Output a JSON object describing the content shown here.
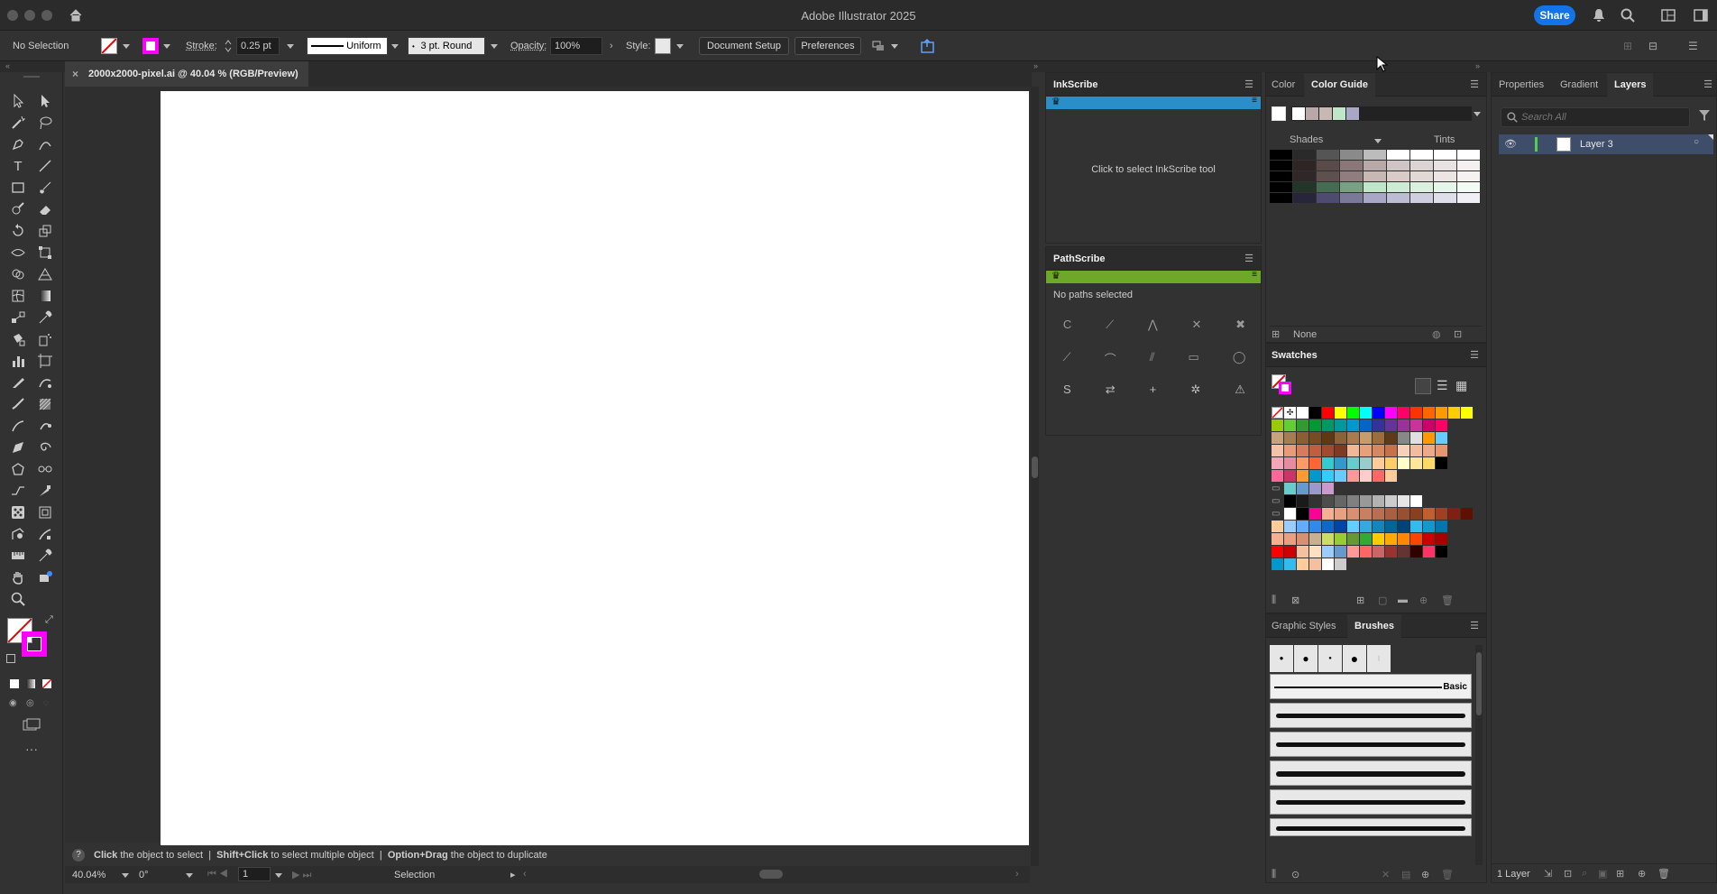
{
  "app": {
    "title": "Adobe Illustrator 2025",
    "share_label": "Share"
  },
  "control": {
    "selection": "No Selection",
    "stroke_label": "Stroke:",
    "stroke_value": "0.25 pt",
    "profile": "Uniform",
    "brush": "3 pt. Round",
    "opacity_label": "Opacity:",
    "opacity_value": "100%",
    "style_label": "Style:",
    "document_setup": "Document Setup",
    "preferences": "Preferences"
  },
  "document": {
    "tab_title": "2000x2000-pixel.ai @ 40.04 % (RGB/Preview)"
  },
  "status": {
    "hint_b1": "Click",
    "hint_t1": " the object to select  |  ",
    "hint_b2": "Shift+Click",
    "hint_t2": " to select multiple object  |  ",
    "hint_b3": "Option+Drag",
    "hint_t3": " the object to duplicate",
    "zoom": "40.04%",
    "rotation": "0°",
    "artboard_num": "1",
    "tool_name": "Selection"
  },
  "inkscribe": {
    "title": "InkScribe",
    "message": "Click to select InkScribe tool"
  },
  "pathscribe": {
    "title": "PathScribe",
    "message": "No paths selected",
    "btn_c": "C",
    "btn_s": "S"
  },
  "color_panel": {
    "tab_color": "Color",
    "tab_guide": "Color Guide",
    "shades_label": "Shades",
    "tints_label": "Tints",
    "none_label": "None",
    "harmony": [
      "#b9a8a8",
      "#c8b8b4",
      "#bfe6c8",
      "#a8a8c6"
    ],
    "grid": [
      [
        "#000000",
        "#2a2a2a",
        "#555555",
        "#8a8a8a",
        "#bcbcbc",
        "#ffffff",
        "#ffffff",
        "#ffffff",
        "#ffffff"
      ],
      [
        "#000000",
        "#2e2525",
        "#5b4a4a",
        "#8b7777",
        "#b9a8a8",
        "#d0c4c4",
        "#dcd3d3",
        "#e8e2e2",
        "#f4f0f0"
      ],
      [
        "#000000",
        "#302828",
        "#5f5050",
        "#907d7d",
        "#c8b8b4",
        "#d8cbc8",
        "#e2d8d6",
        "#ece5e4",
        "#f5f2f1"
      ],
      [
        "#000000",
        "#233528",
        "#456b52",
        "#77a182",
        "#bfe6c8",
        "#cdecd4",
        "#daf1df",
        "#e6f6ea",
        "#f2fbf4"
      ],
      [
        "#000000",
        "#26253a",
        "#4d4b70",
        "#7b7999",
        "#a8a8c6",
        "#bcbcd3",
        "#ceceDF",
        "#dfdfeb",
        "#efeff5"
      ]
    ]
  },
  "swatches": {
    "title": "Swatches",
    "row1": [
      "#ffffff",
      "#000000",
      "#ff0000",
      "#ffff00",
      "#00ff00",
      "#00ffff",
      "#0000ff",
      "#ff00ff",
      "#ff0066",
      "#ff3300",
      "#ff6600",
      "#ff9900",
      "#ffcc00",
      "#ffff00"
    ],
    "row2": [
      "#99cc00",
      "#66cc33",
      "#339933",
      "#009933",
      "#009966",
      "#009999",
      "#0099cc",
      "#0066cc",
      "#333399",
      "#663399",
      "#993399",
      "#cc3399",
      "#cc0066",
      "#ff0066"
    ],
    "row3": [
      "#c8a27a",
      "#a67c52",
      "#8b5e34",
      "#754c24",
      "#603913",
      "#8c6239",
      "#a87c4f",
      "#c69c6d",
      "#9c6e3e",
      "#5c3a1a",
      "#888888",
      "#e0e0e0",
      "#ff9900",
      "#66ccff"
    ],
    "row4": [
      "#f4c2a8",
      "#e89a7a",
      "#d67c5e",
      "#c05f40",
      "#a04a30",
      "#803a24",
      "#f0b896",
      "#e8a07a",
      "#d88860",
      "#c87048",
      "#f6d0b8",
      "#f2bca0",
      "#eeaa88",
      "#e89670"
    ],
    "row5": [
      "#f4a6b8",
      "#e88aa0",
      "#ff9966",
      "#ff6633",
      "#33cccc",
      "#3399cc",
      "#66cccc",
      "#99cccc",
      "#ffcc99",
      "#ffcc66",
      "#ffffcc",
      "#ffe699",
      "#ffd966",
      "#000000"
    ],
    "row6": [
      "#ff6699",
      "#cc3366",
      "#ff9933",
      "#0099cc",
      "#33ccff",
      "#66ccff",
      "#ff9999",
      "#ffcccc",
      "#ff6666",
      "#ffcc99"
    ],
    "row7": [
      "#66cccc",
      "#6699cc",
      "#9999cc",
      "#cc99cc"
    ],
    "row8": [
      "#000000",
      "#1a1a1a",
      "#333333",
      "#4d4d4d",
      "#666666",
      "#808080",
      "#999999",
      "#b3b3b3",
      "#cccccc",
      "#e6e6e6",
      "#ffffff"
    ],
    "row9": [
      "#ffffff",
      "#000000",
      "#ff0099",
      "#f4b090",
      "#e8a080",
      "#d89070",
      "#c88060",
      "#b87050",
      "#a86040",
      "#985030",
      "#884020",
      "#c06030",
      "#a04020",
      "#802010",
      "#601000"
    ],
    "row10": [
      "#ffcc99",
      "#99ccff",
      "#66aaff",
      "#3388ee",
      "#1166cc",
      "#0044aa",
      "#66ccff",
      "#33aadd",
      "#1188bb",
      "#006699",
      "#004477",
      "#33bbee",
      "#1199cc",
      "#0077aa"
    ],
    "row11": [
      "#f4b090",
      "#e8a080",
      "#d89070",
      "#c8b090",
      "#ccdd66",
      "#99cc33",
      "#669933",
      "#33aa33",
      "#ffcc00",
      "#ffaa00",
      "#ff8800",
      "#ff4400",
      "#cc0000",
      "#aa0000"
    ],
    "row12": [
      "#ff0000",
      "#cc0000",
      "#f4c0a0",
      "#ffe0c0",
      "#99ccff",
      "#6699cc",
      "#ff9999",
      "#ff6666",
      "#cc6666",
      "#993333",
      "#663333",
      "#330000",
      "#ff3366",
      "#000000"
    ],
    "row13": [
      "#0099cc",
      "#33bbee",
      "#ffcc99",
      "#f4c0a0",
      "#ffffff",
      "#cccccc"
    ]
  },
  "graphic_styles": {
    "tab_styles": "Graphic Styles",
    "tab_brushes": "Brushes",
    "basic_label": "Basic"
  },
  "layers_panel": {
    "tab_properties": "Properties",
    "tab_gradient": "Gradient",
    "tab_layers": "Layers",
    "search_placeholder": "Search All",
    "layer_name": "Layer 3",
    "count": "1 Layer"
  }
}
